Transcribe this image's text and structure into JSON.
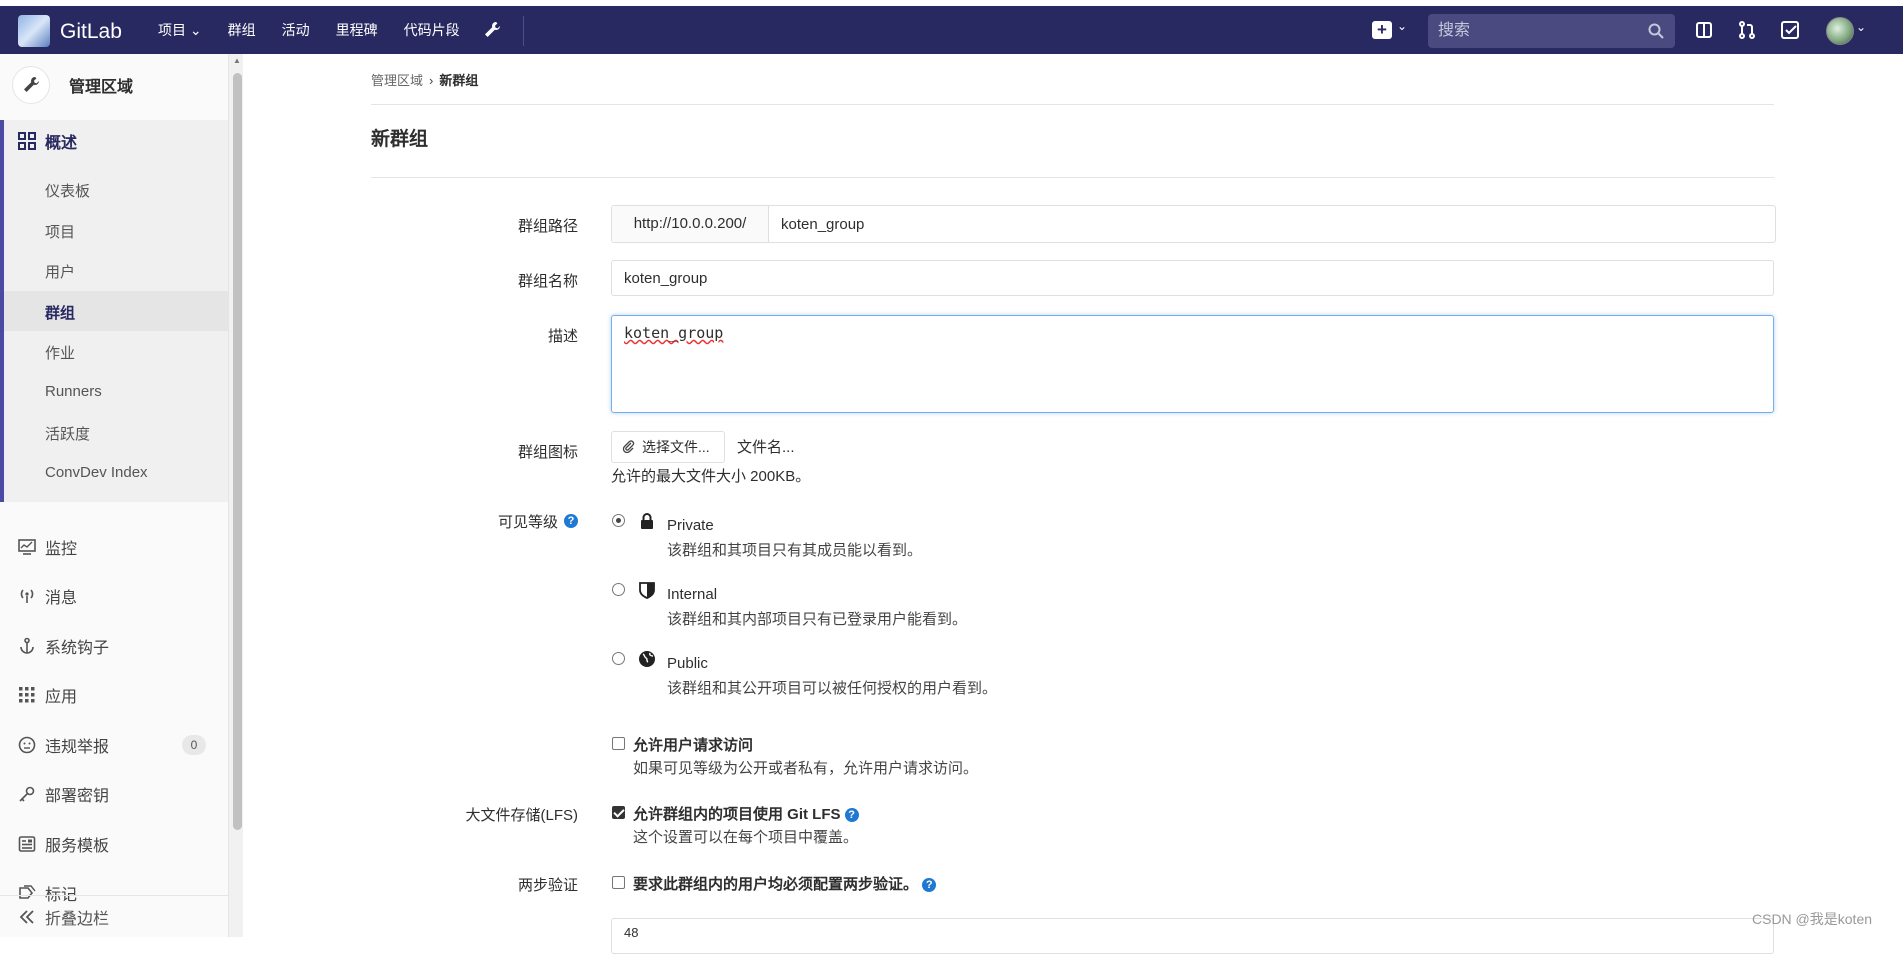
{
  "navbar": {
    "brand": "GitLab",
    "links": [
      "项目",
      "群组",
      "活动",
      "里程碑",
      "代码片段"
    ],
    "search_placeholder": "搜索"
  },
  "sidebar": {
    "header": "管理区域",
    "overview": "概述",
    "sub_items": [
      "仪表板",
      "项目",
      "用户",
      "群组",
      "作业",
      "Runners",
      "活跃度",
      "ConvDev Index"
    ],
    "active_sub": "群组",
    "items": [
      {
        "label": "监控",
        "icon": "monitor-icon"
      },
      {
        "label": "消息",
        "icon": "broadcast-icon"
      },
      {
        "label": "系统钩子",
        "icon": "anchor-icon"
      },
      {
        "label": "应用",
        "icon": "apps-grid-icon"
      },
      {
        "label": "违规举报",
        "icon": "smiley-icon",
        "badge": "0"
      },
      {
        "label": "部署密钥",
        "icon": "key-icon"
      },
      {
        "label": "服务模板",
        "icon": "template-icon"
      },
      {
        "label": "标记",
        "icon": "labels-icon"
      }
    ],
    "collapse": "折叠边栏"
  },
  "breadcrumb": {
    "parent": "管理区域",
    "sep": "›",
    "current": "新群组"
  },
  "page_title": "新群组",
  "form": {
    "path_label": "群组路径",
    "path_prefix": "http://10.0.0.200/",
    "path_value": "koten_group",
    "name_label": "群组名称",
    "name_value": "koten_group",
    "desc_label": "描述",
    "desc_value": "koten_group",
    "avatar_label": "群组图标",
    "choose_file": "选择文件...",
    "file_name": "文件名...",
    "max_size": "允许的最大文件大小 200KB。",
    "visibility_label": "可见等级",
    "visibility": [
      {
        "title": "Private",
        "desc": "该群组和其项目只有其成员能以看到。",
        "checked": true,
        "icon": "lock-icon"
      },
      {
        "title": "Internal",
        "desc": "该群组和其内部项目只有已登录用户能看到。",
        "checked": false,
        "icon": "shield-icon"
      },
      {
        "title": "Public",
        "desc": "该群组和其公开项目可以被任何授权的用户看到。",
        "checked": false,
        "icon": "globe-icon"
      }
    ],
    "request_access_title": "允许用户请求访问",
    "request_access_desc": "如果可见等级为公开或者私有，允许用户请求访问。",
    "lfs_label": "大文件存储(LFS)",
    "lfs_title": "允许群组内的项目使用 Git LFS",
    "lfs_desc": "这个设置可以在每个项目中覆盖。",
    "twofa_label": "两步验证",
    "twofa_title": "要求此群组内的用户均必须配置两步验证。",
    "bottom_value": "48"
  },
  "watermark": "CSDN @我是koten"
}
